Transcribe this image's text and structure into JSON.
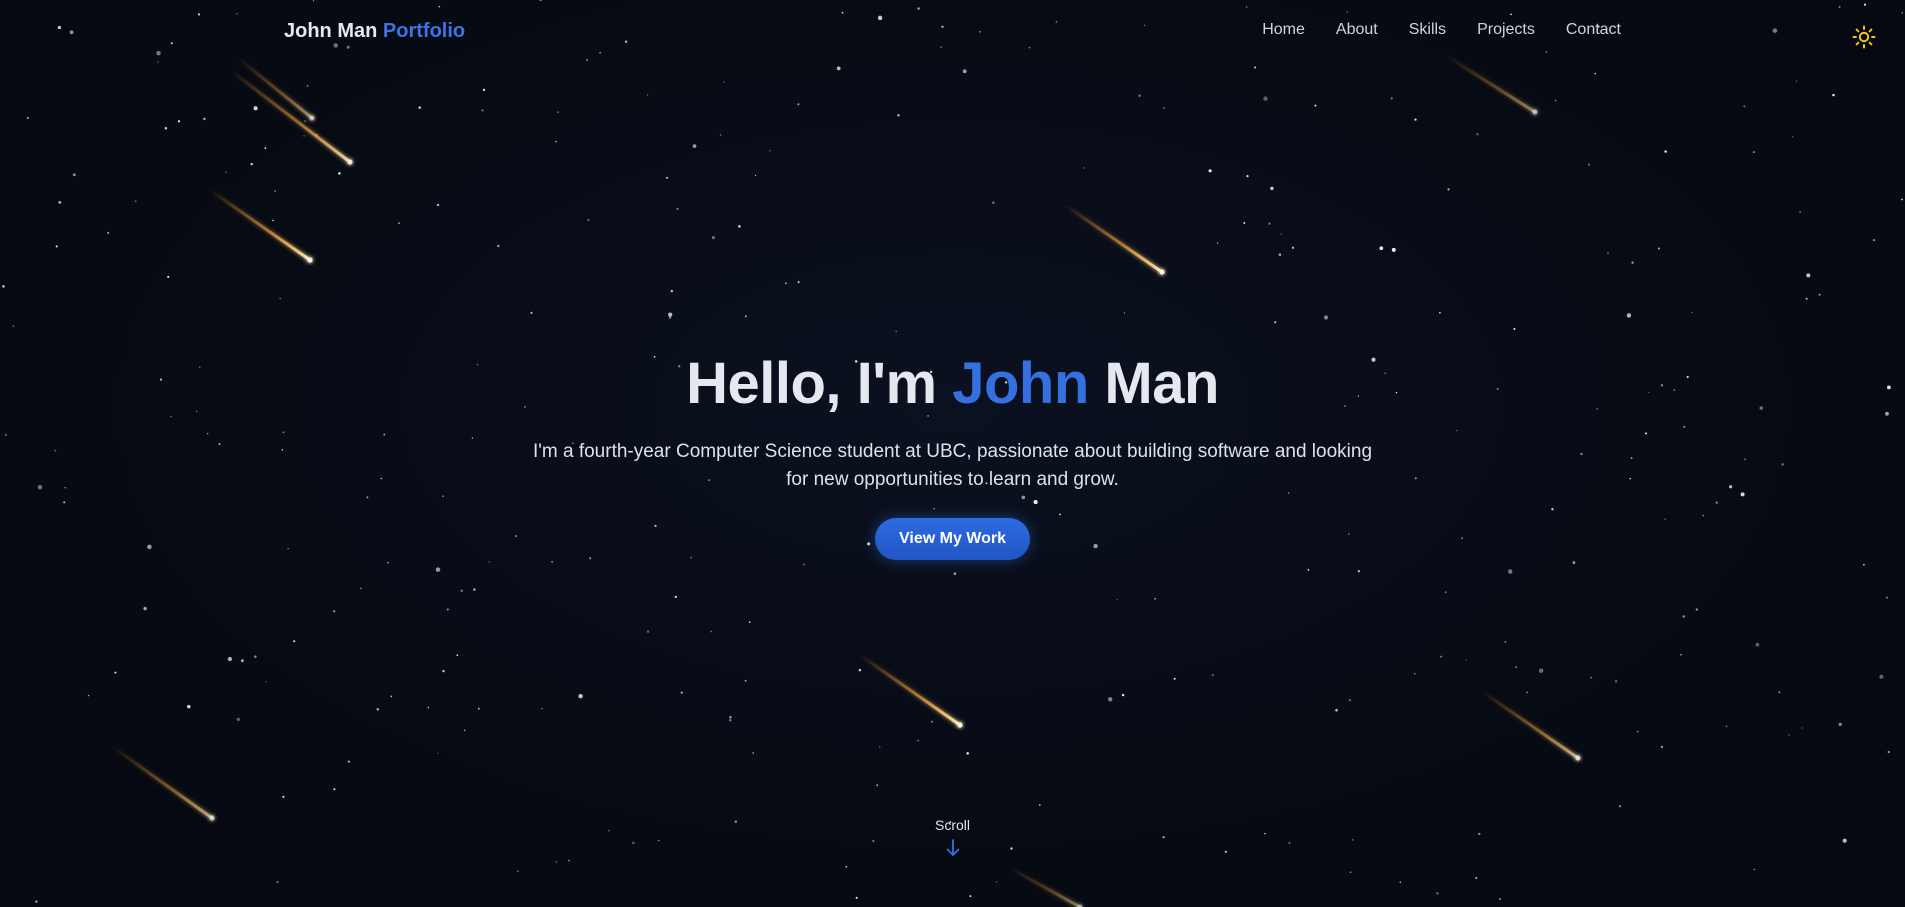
{
  "header": {
    "brand_name": "John Man",
    "brand_accent": "Portfolio",
    "nav": [
      "Home",
      "About",
      "Skills",
      "Projects",
      "Contact"
    ],
    "theme_icon": "sun-icon"
  },
  "hero": {
    "greeting_prefix": "Hello, I'm",
    "first_name": "John",
    "last_name": "Man",
    "description": "I'm a fourth-year Computer Science student at UBC, passionate about building software and looking for new opportunities to learn and grow.",
    "cta_label": "View My Work"
  },
  "scroll": {
    "label": "Scroll",
    "icon": "arrow-down-icon"
  },
  "colors": {
    "background": "#070b14",
    "accent": "#3570e0",
    "text": "#e5e8ef",
    "meteor": "#ffb347",
    "theme_icon": "#f5c518"
  }
}
